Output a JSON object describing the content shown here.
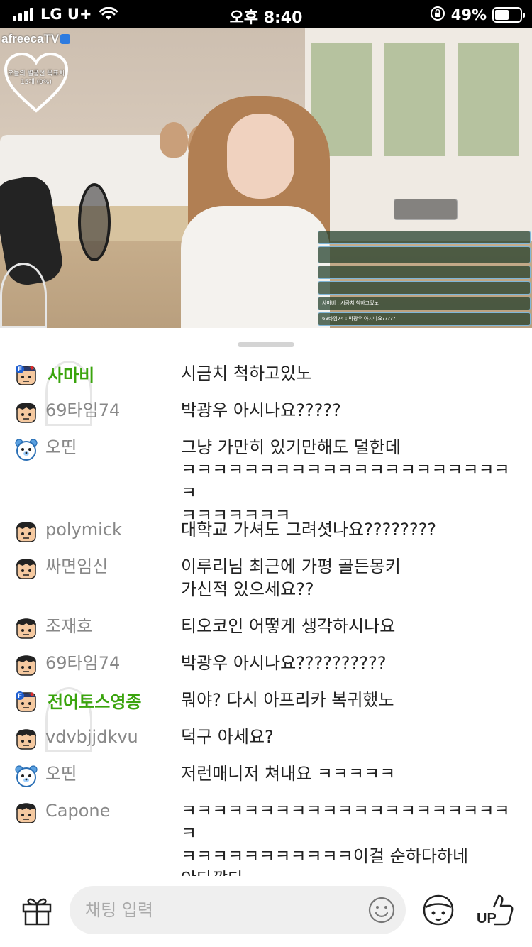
{
  "status_bar": {
    "carrier": "LG U+",
    "time": "오후 8:40",
    "battery": "49%"
  },
  "video": {
    "logo": "afreecaTV",
    "heart_goal_line1": "오늘의 별풍선 목표치",
    "heart_goal_line2": "15개 (0%)",
    "overlay_chat": [
      "사마비 : 시금치 척하고있노",
      "69타임74 : 박광우 아시나요?????"
    ]
  },
  "chat": {
    "messages": [
      {
        "nickname": "사마비",
        "fan": true,
        "avatar": "fan-avatar-icon",
        "lines": [
          "시금치 척하고있노"
        ]
      },
      {
        "nickname": "69타임74",
        "fan": false,
        "avatar": "user-avatar-icon",
        "lines": [
          "박광우 아시나요?????"
        ]
      },
      {
        "nickname": "오띤",
        "fan": false,
        "avatar": "bear-avatar-icon",
        "lines": [
          "그냥 가만히 있기만해도 덜한데",
          "ㅋㅋㅋㅋㅋㅋㅋㅋㅋㅋㅋㅋㅋㅋㅋㅋㅋㅋㅋㅋㅋㅋ",
          "ㅋㅋㅋㅋㅋㅋㅋ"
        ]
      },
      {
        "nickname": "polymick",
        "fan": false,
        "avatar": "user-avatar-icon",
        "lines": [
          "대학교 가셔도 그려셧나요????????"
        ]
      },
      {
        "nickname": "싸면임신",
        "fan": false,
        "avatar": "user-avatar-icon",
        "lines": [
          "이루리님 최근에 가평 골든몽키",
          "가신적 있으세요??"
        ]
      },
      {
        "nickname": "조재호",
        "fan": false,
        "avatar": "user-avatar-icon",
        "lines": [
          "티오코인 어떻게 생각하시나요"
        ]
      },
      {
        "nickname": "69타임74",
        "fan": false,
        "avatar": "user-avatar-icon",
        "lines": [
          "박광우 아시나요??????????"
        ]
      },
      {
        "nickname": "전어토스영종",
        "fan": true,
        "avatar": "fan-avatar-icon",
        "lines": [
          "뭐야? 다시 아프리카 복귀했노"
        ]
      },
      {
        "nickname": "vdvbjjdkvu",
        "fan": false,
        "avatar": "user-avatar-icon",
        "lines": [
          "덕구 아세요?"
        ]
      },
      {
        "nickname": "오띤",
        "fan": false,
        "avatar": "bear-avatar-icon",
        "lines": [
          "저런매니저 쳐내요 ㅋㅋㅋㅋㅋ"
        ]
      },
      {
        "nickname": "Capone",
        "fan": false,
        "avatar": "user-avatar-icon",
        "lines": [
          "ㅋㅋㅋㅋㅋㅋㅋㅋㅋㅋㅋㅋㅋㅋㅋㅋㅋㅋㅋㅋㅋㅋ",
          "ㅋㅋㅋㅋㅋㅋㅋㅋㅋㅋㅋ이걸 순하다하네",
          "안타깝다,,"
        ]
      }
    ]
  },
  "bottom_bar": {
    "input_placeholder": "채팅 입력",
    "up_label": "UP"
  },
  "colors": {
    "fan_nickname": "#3aa40d",
    "nickname": "#888888",
    "message_text": "#222222"
  }
}
